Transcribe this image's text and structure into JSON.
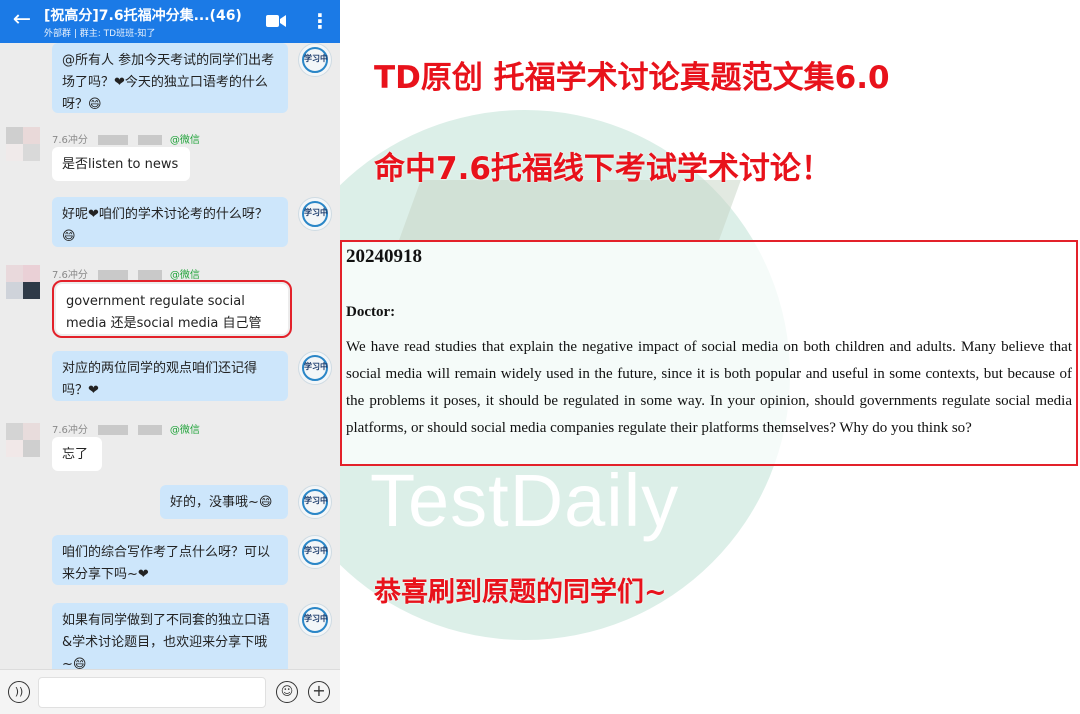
{
  "chat": {
    "header": {
      "title": "[祝高分]7.6托福冲分集...(46)",
      "subtitle": "外部群 | 群主: TD班班-知了"
    },
    "messages": [
      {
        "side": "me",
        "text": "@所有人  参加今天考试的同学们出考场了吗？❤今天的独立口语考的什么呀？😄"
      },
      {
        "side": "other",
        "meta_time": "7.6冲分",
        "meta_source": "@微信",
        "text": "是否listen to news"
      },
      {
        "side": "me",
        "text": "好呢❤咱们的学术讨论考的什么呀？😄"
      },
      {
        "side": "other",
        "meta_time": "7.6冲分",
        "meta_source": "@微信",
        "text": "government regulate social media 还是social media 自己管"
      },
      {
        "side": "me",
        "text": "对应的两位同学的观点咱们还记得吗？❤"
      },
      {
        "side": "other",
        "meta_time": "7.6冲分",
        "meta_source": "@微信",
        "text": "忘了"
      },
      {
        "side": "me",
        "text": "好的，没事哦~😄"
      },
      {
        "side": "me",
        "text": "咱们的综合写作考了点什么呀？可以来分享下吗~❤"
      },
      {
        "side": "me",
        "text": "如果有同学做到了不同套的独立口语&学术讨论题目，也欢迎来分享下哦~😄"
      }
    ],
    "avatar_label": "学习中",
    "input_placeholder": ""
  },
  "poster": {
    "headline1": "TD原创 托福学术讨论真题范文集6.0",
    "headline2": "命中7.6托福线下考试学术讨论！",
    "date": "20240918",
    "role": "Doctor:",
    "prompt": "We have read studies that explain the negative impact of social media on both children and adults. Many believe that social media will remain widely used in the future, since it is both popular and useful in some contexts, but because of the problems it poses, it should be regulated in some way. In your opinion, should governments regulate social media platforms, or should social media companies regulate their platforms themselves? Why do you think so?",
    "watermark": "TestDaily",
    "footer": "恭喜刷到原题的同学们~"
  },
  "colors": {
    "accent_red": "#e3212a",
    "header_blue": "#1b7ae6",
    "bubble_blue": "#cde6fb"
  }
}
